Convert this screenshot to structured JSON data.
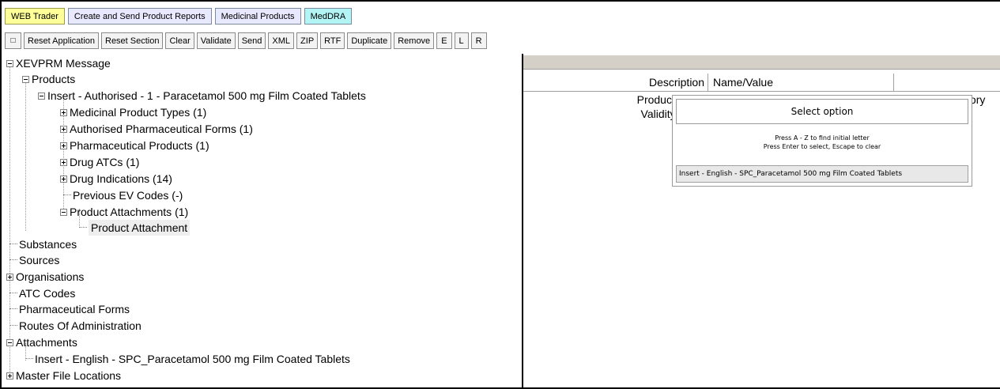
{
  "tabs": [
    "WEB Trader",
    "Create and Send Product Reports",
    "Medicinal Products",
    "MedDRA"
  ],
  "toolbar": {
    "square_icon": "□",
    "buttons": [
      "Reset Application",
      "Reset Section",
      "Clear",
      "Validate",
      "Send",
      "XML",
      "ZIP",
      "RTF",
      "Duplicate",
      "Remove",
      "E",
      "L",
      "R"
    ]
  },
  "tree": {
    "root": "XEVPRM Message",
    "products": "Products",
    "insert_product": "Insert - Authorised - 1 - Paracetamol 500 mg Film Coated Tablets",
    "medicinal_product_types": "Medicinal Product Types (1)",
    "authorised_pharmaceutical_forms": "Authorised Pharmaceutical Forms (1)",
    "pharmaceutical_products": "Pharmaceutical Products (1)",
    "drug_atcs": "Drug ATCs (1)",
    "drug_indications": "Drug Indications (14)",
    "previous_ev_codes": "Previous EV Codes (-)",
    "product_attachments": "Product Attachments (1)",
    "product_attachment": "Product Attachment",
    "substances": "Substances",
    "sources": "Sources",
    "organisations": "Organisations",
    "atc_codes": "ATC Codes",
    "pharmaceutical_forms": "Pharmaceutical Forms",
    "routes_of_administration": "Routes Of Administration",
    "attachments": "Attachments",
    "insert_attachment": "Insert - English - SPC_Paracetamol 500 mg Film Coated Tablets",
    "master_file_locations": "Master File Locations"
  },
  "grid": {
    "col_description": "Description",
    "col_name_value": "Name/Value",
    "rows": [
      {
        "description": "Product Attacl",
        "mandatory": "Field is Mandatory"
      },
      {
        "description": "Validity decla",
        "mandatory": ""
      }
    ]
  },
  "popup": {
    "title": "Select option",
    "help_line1": "Press A - Z to find initial letter",
    "help_line2": "Press Enter to select, Escape to clear",
    "option": "Insert - English - SPC_Paracetamol 500 mg Film Coated Tablets"
  }
}
